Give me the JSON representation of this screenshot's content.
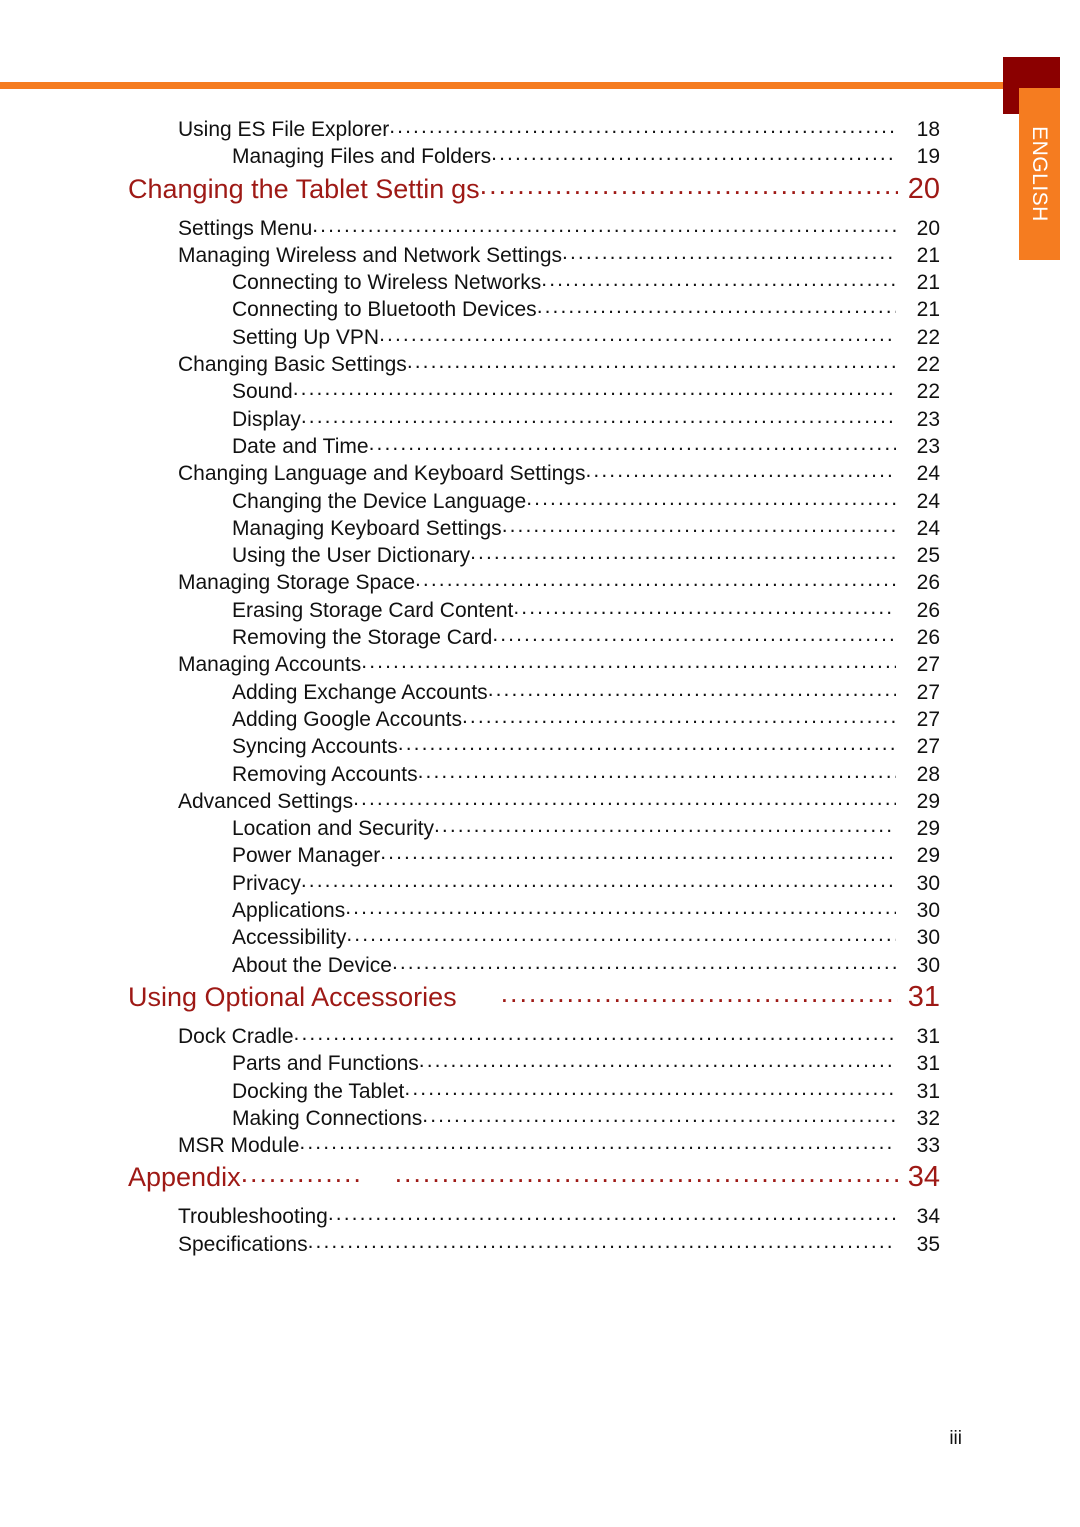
{
  "language_tab": {
    "label": "ENGLISH"
  },
  "footer": {
    "page_number": "iii"
  },
  "colors": {
    "heading_red": "#9E1915",
    "accent_orange": "#F57C20",
    "accent_maroon": "#8B0000",
    "body_text": "#111111"
  },
  "toc": {
    "entries": [
      {
        "level": "l1",
        "title": "Using ES File Explorer",
        "page": "18"
      },
      {
        "level": "l2",
        "title": "Managing Files and Folders",
        "page": "19"
      },
      {
        "level": "heading",
        "title": "Changing the Tablet Settin",
        "title_part2": "gs",
        "page": "20"
      },
      {
        "level": "l1",
        "title": "Settings Menu",
        "page": "20"
      },
      {
        "level": "l1",
        "title": "Managing Wireless and Network Settings",
        "page": "21"
      },
      {
        "level": "l2",
        "title": "Connecting to Wireless Networks",
        "page": "21"
      },
      {
        "level": "l2",
        "title": "Connecting to Bluetooth Devices",
        "page": "21"
      },
      {
        "level": "l2",
        "title": "Setting Up VPN",
        "page": "22"
      },
      {
        "level": "l1",
        "title": "Changing Basic Settings",
        "page": "22"
      },
      {
        "level": "l2",
        "title": "Sound",
        "page": "22"
      },
      {
        "level": "l2",
        "title": "Display",
        "page": "23"
      },
      {
        "level": "l2",
        "title": "Date and Time",
        "page": "23"
      },
      {
        "level": "l1",
        "title": "Changing Language and Keyboard Settings",
        "page": "24"
      },
      {
        "level": "l2",
        "title": "Changing the Device Language",
        "page": "24"
      },
      {
        "level": "l2",
        "title": "Managing Keyboard Settings",
        "page": "24"
      },
      {
        "level": "l2",
        "title": "Using the User Dictionary",
        "page": "25"
      },
      {
        "level": "l1",
        "title": "Managing Storage Space",
        "page": "26"
      },
      {
        "level": "l2",
        "title": "Erasing Storage Card Content",
        "page": "26"
      },
      {
        "level": "l2",
        "title": "Removing the Storage Card",
        "page": "26"
      },
      {
        "level": "l1",
        "title": "Managing Accounts",
        "page": "27"
      },
      {
        "level": "l2",
        "title": "Adding Exchange Accounts",
        "page": "27"
      },
      {
        "level": "l2",
        "title": "Adding Google Accounts",
        "page": "27"
      },
      {
        "level": "l2",
        "title": "Syncing Accounts",
        "page": "27"
      },
      {
        "level": "l2",
        "title": "Removing Accounts",
        "page": "28"
      },
      {
        "level": "l1",
        "title": "Advanced Settings",
        "page": "29"
      },
      {
        "level": "l2",
        "title": "Location and Security",
        "page": "29"
      },
      {
        "level": "l2",
        "title": "Power Manager",
        "page": "29"
      },
      {
        "level": "l2",
        "title": "Privacy",
        "page": "30"
      },
      {
        "level": "l2",
        "title": "Applications",
        "page": "30"
      },
      {
        "level": "l2",
        "title": "Accessibility",
        "page": "30"
      },
      {
        "level": "l2",
        "title": "About the Device",
        "page": "30"
      },
      {
        "level": "heading",
        "title": "Using Optional Accessories",
        "page": "31"
      },
      {
        "level": "l1",
        "title": "Dock Cradle",
        "page": "31"
      },
      {
        "level": "l2",
        "title": "Parts and Functions",
        "page": "31"
      },
      {
        "level": "l2",
        "title": "Docking the Tablet",
        "page": "31"
      },
      {
        "level": "l2",
        "title": "Making Connections",
        "page": "32"
      },
      {
        "level": "l1",
        "title": "MSR Module",
        "page": "33"
      },
      {
        "level": "heading",
        "title": "Appendix",
        "page": "34"
      },
      {
        "level": "l1",
        "title": "Troubleshooting",
        "page": "34"
      },
      {
        "level": "l1",
        "title": "Specifications",
        "page": "35"
      }
    ]
  }
}
